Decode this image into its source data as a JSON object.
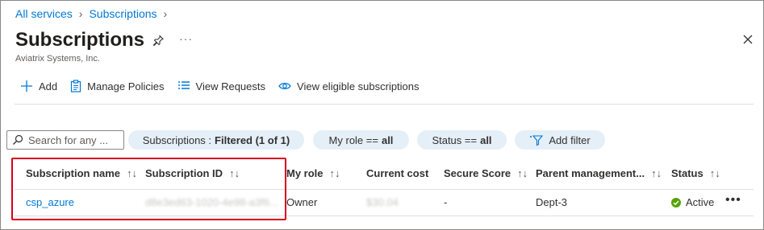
{
  "breadcrumb": {
    "items": [
      "All services",
      "Subscriptions"
    ]
  },
  "header": {
    "title": "Subscriptions",
    "subtitle": "Aviatrix Systems, Inc.",
    "more_label": "···"
  },
  "toolbar": {
    "add": "Add",
    "manage_policies": "Manage Policies",
    "view_requests": "View Requests",
    "view_eligible": "View eligible subscriptions"
  },
  "filters": {
    "search_placeholder": "Search for any ...",
    "subscriptions_prefix": "Subscriptions :",
    "subscriptions_value": "Filtered (1 of 1)",
    "role_prefix": "My role ==",
    "role_value": "all",
    "status_prefix": "Status ==",
    "status_value": "all",
    "add_filter": "Add filter"
  },
  "table": {
    "columns": [
      "Subscription name",
      "Subscription ID",
      "My role",
      "Current cost",
      "Secure Score",
      "Parent management...",
      "Status"
    ],
    "sort_glyph": "↑↓",
    "rows": [
      {
        "name": "csp_azure",
        "id": "d8e3ed63-1020-4e98-a3f6...",
        "role": "Owner",
        "cost": "$30.04",
        "secure_score": "-",
        "parent": "Dept-3",
        "status": "Active",
        "more": "•••"
      }
    ]
  },
  "colors": {
    "accent": "#0078d4",
    "pill_bg": "#e5eff8",
    "highlight": "#d9001b",
    "active": "#57a300"
  }
}
